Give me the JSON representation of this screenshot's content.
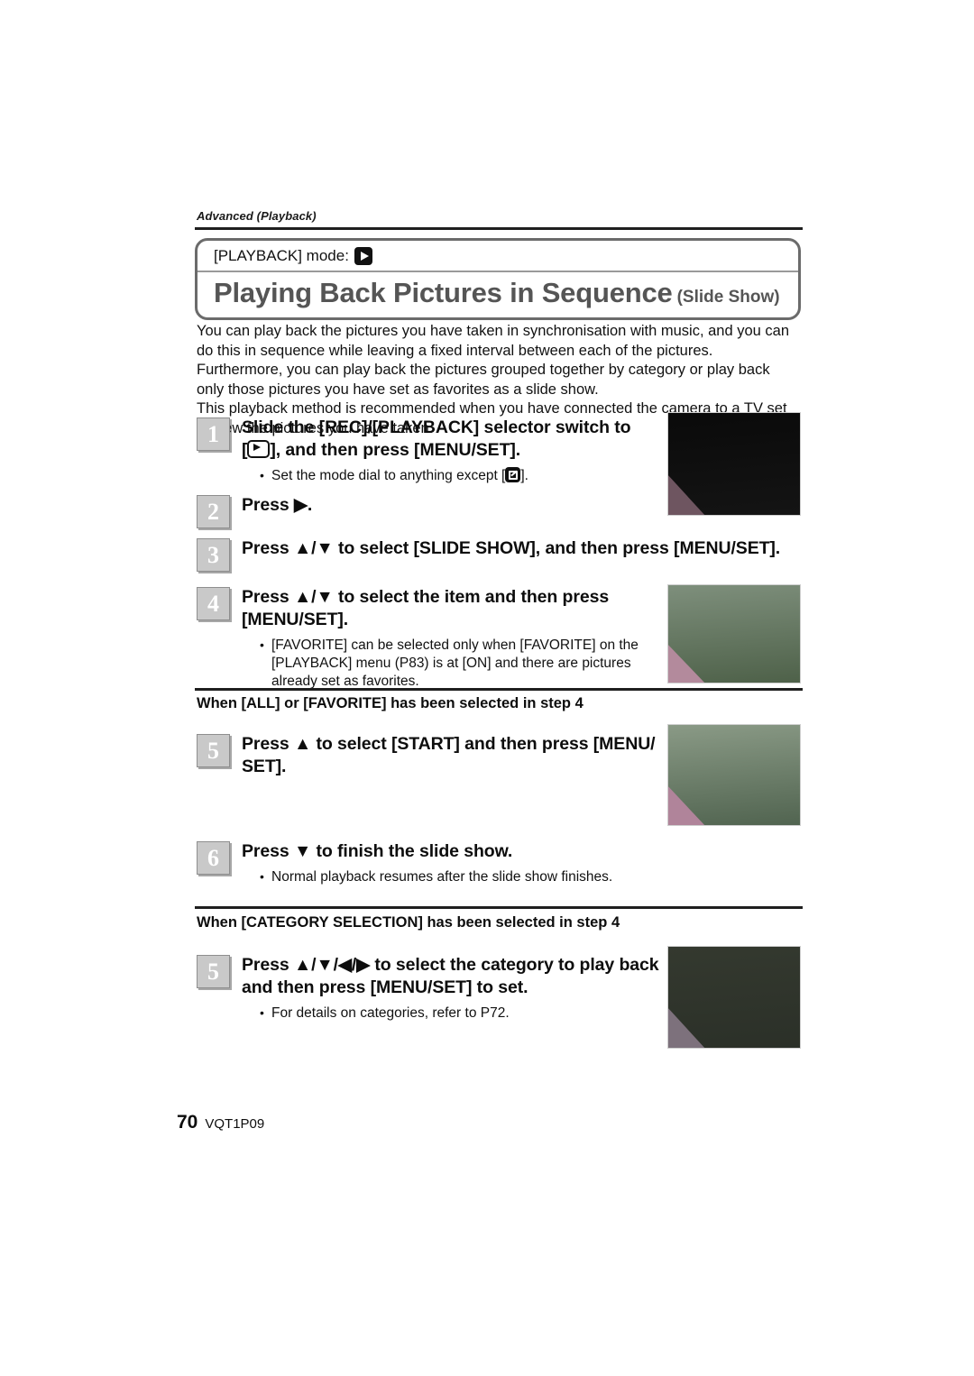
{
  "running_head": "Advanced (Playback)",
  "title_box": {
    "mode_label": "[PLAYBACK] mode:",
    "mode_icon": "playback-mode-icon",
    "title_main": "Playing Back Pictures in Sequence",
    "title_sub": "(Slide Show)"
  },
  "intro": {
    "p1": "You can play back the pictures you have taken in synchronisation with music, and you can do this in sequence while leaving a fixed interval between each of the pictures.",
    "p2": "Furthermore, you can play back the pictures grouped together by category or play back only those pictures you have set as favorites as a slide show.",
    "p3": "This playback method is recommended when you have connected the camera to a TV set to view the pictures you have taken."
  },
  "steps": [
    {
      "num": "1",
      "title_a": "Slide the [REC]/[PLAYBACK] selector switch to",
      "title_b_pre": "[",
      "title_b_post": "], and then press [MENU/SET].",
      "bullet_pre": "Set the mode dial to anything except [",
      "bullet_post": "]."
    },
    {
      "num": "2",
      "title": "Press ▶."
    },
    {
      "num": "3",
      "title": "Press ▲/▼ to select [SLIDE SHOW], and then press [MENU/SET]."
    },
    {
      "num": "4",
      "title": "Press ▲/▼ to select the item and then press [MENU/SET].",
      "bullet": "[FAVORITE] can be selected only when [FAVORITE] on the [PLAYBACK] menu (P83) is at [ON] and there are pictures already set as favorites."
    }
  ],
  "section_all": {
    "heading": "When [ALL] or [FAVORITE] has been selected in step 4",
    "steps": [
      {
        "num": "5",
        "title": "Press ▲ to select [START] and then press [MENU/ SET]."
      },
      {
        "num": "6",
        "title": "Press ▼ to finish the slide show.",
        "bullet": "Normal playback resumes after the slide show finishes."
      }
    ]
  },
  "section_category": {
    "heading": "When [CATEGORY SELECTION] has been selected in step 4",
    "steps": [
      {
        "num": "5",
        "title": "Press ▲/▼/◀/▶ to select the category to play back and then press [MENU/SET] to set.",
        "bullet": "For details on categories, refer to P72."
      }
    ]
  },
  "thumbnails": [
    {
      "name": "thumb-dark-scene",
      "top": "#0a0a0a",
      "bottom": "#141414",
      "corner": "#6e5560"
    },
    {
      "name": "thumb-grass-1",
      "top": "#7e8f7c",
      "bottom": "#4e6149",
      "corner": "#b38a9c"
    },
    {
      "name": "thumb-grass-2",
      "top": "#8a9a86",
      "bottom": "#516450",
      "corner": "#b0849a"
    },
    {
      "name": "thumb-dark-grass",
      "top": "#34392f",
      "bottom": "#2b3028",
      "corner": "#7d717c"
    }
  ],
  "footer": {
    "page_number": "70",
    "doc_code": "VQT1P09"
  }
}
